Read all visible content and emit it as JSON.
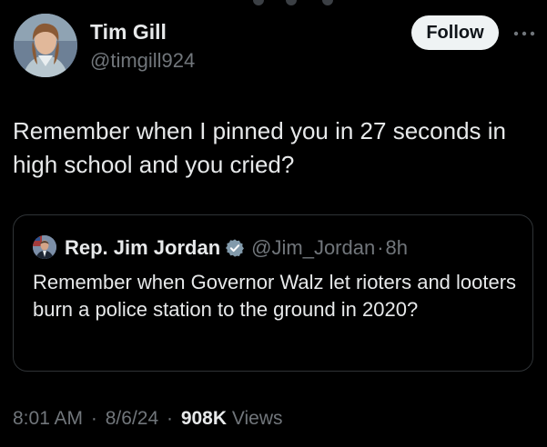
{
  "tweet": {
    "author": {
      "name": "Tim Gill",
      "handle": "@timgill924"
    },
    "follow_label": "Follow",
    "text": "Remember when I pinned you in 27 seconds in high school and you cried?",
    "quoted": {
      "author_name": "Rep. Jim Jordan",
      "author_handle": "@Jim_Jordan",
      "separator": "·",
      "time_ago": "8h",
      "text": "Remember when Governor Walz let rioters and looters burn a police station to the ground in 2020?"
    },
    "meta": {
      "time": "8:01 AM",
      "separator": "·",
      "date": "8/6/24",
      "views_count": "908K",
      "views_label": "Views"
    }
  },
  "icons": {
    "more": "more-horizontal-icon",
    "verified": "verified-badge-icon"
  },
  "colors": {
    "background": "#000000",
    "primary_text": "#e7e9ea",
    "secondary_text": "#71767b",
    "follow_button_bg": "#eff3f4",
    "follow_button_text": "#0f1419",
    "border": "#2f3336",
    "verified_badge": "#829aab"
  }
}
